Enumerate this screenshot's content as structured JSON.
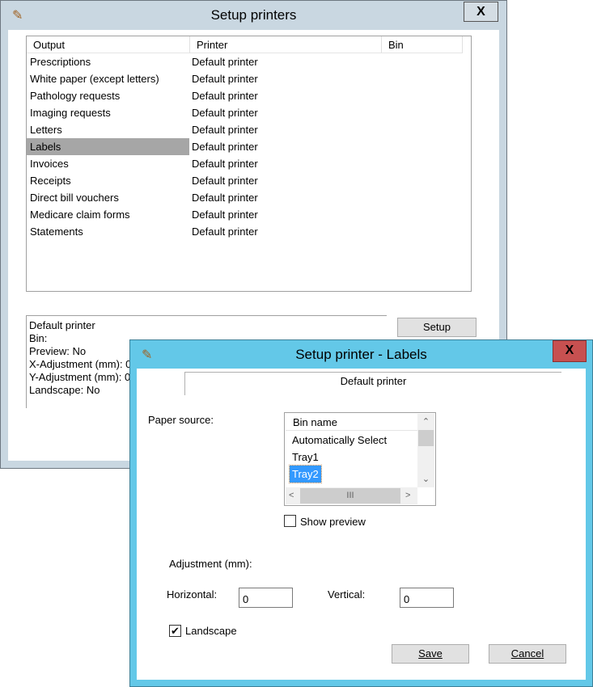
{
  "main_window": {
    "title": "Setup printers",
    "close": "X",
    "columns": [
      "Output",
      "Printer",
      "Bin"
    ],
    "rows": [
      {
        "output": "Prescriptions",
        "printer": "Default printer",
        "bin": ""
      },
      {
        "output": "White paper (except letters)",
        "printer": "Default printer",
        "bin": ""
      },
      {
        "output": "Pathology requests",
        "printer": "Default printer",
        "bin": ""
      },
      {
        "output": "Imaging requests",
        "printer": "Default printer",
        "bin": ""
      },
      {
        "output": "Letters",
        "printer": "Default printer",
        "bin": ""
      },
      {
        "output": "Labels",
        "printer": "Default printer",
        "bin": "",
        "selected": true
      },
      {
        "output": "Invoices",
        "printer": "Default printer",
        "bin": ""
      },
      {
        "output": "Receipts",
        "printer": "Default printer",
        "bin": ""
      },
      {
        "output": "Direct bill vouchers",
        "printer": "Default printer",
        "bin": ""
      },
      {
        "output": "Medicare claim forms",
        "printer": "Default printer",
        "bin": ""
      },
      {
        "output": "Statements",
        "printer": "Default printer",
        "bin": ""
      }
    ],
    "info": [
      "Default printer",
      "Bin:",
      "Preview: No",
      "X-Adjustment (mm): 0",
      "Y-Adjustment (mm): 0",
      "Landscape: No"
    ],
    "setup_label": "Setup"
  },
  "dialog": {
    "title": "Setup printer - Labels",
    "close": "X",
    "tab": "Default printer",
    "paper_source_label": "Paper source:",
    "bin_header": "Bin name",
    "bins": [
      "Automatically Select",
      "Tray1",
      "Tray2"
    ],
    "selected_bin": "Tray2",
    "show_preview_label": "Show preview",
    "show_preview": false,
    "adjustment_label": "Adjustment (mm):",
    "horizontal_label": "Horizontal:",
    "horizontal_value": "0",
    "vertical_label": "Vertical:",
    "vertical_value": "0",
    "landscape_label": "Landscape",
    "landscape": true,
    "save_label": "Save",
    "cancel_label": "Cancel"
  },
  "colors": {
    "dialog_frame": "#63c8e8",
    "close_red": "#c75050",
    "selection": "#3399ff"
  }
}
